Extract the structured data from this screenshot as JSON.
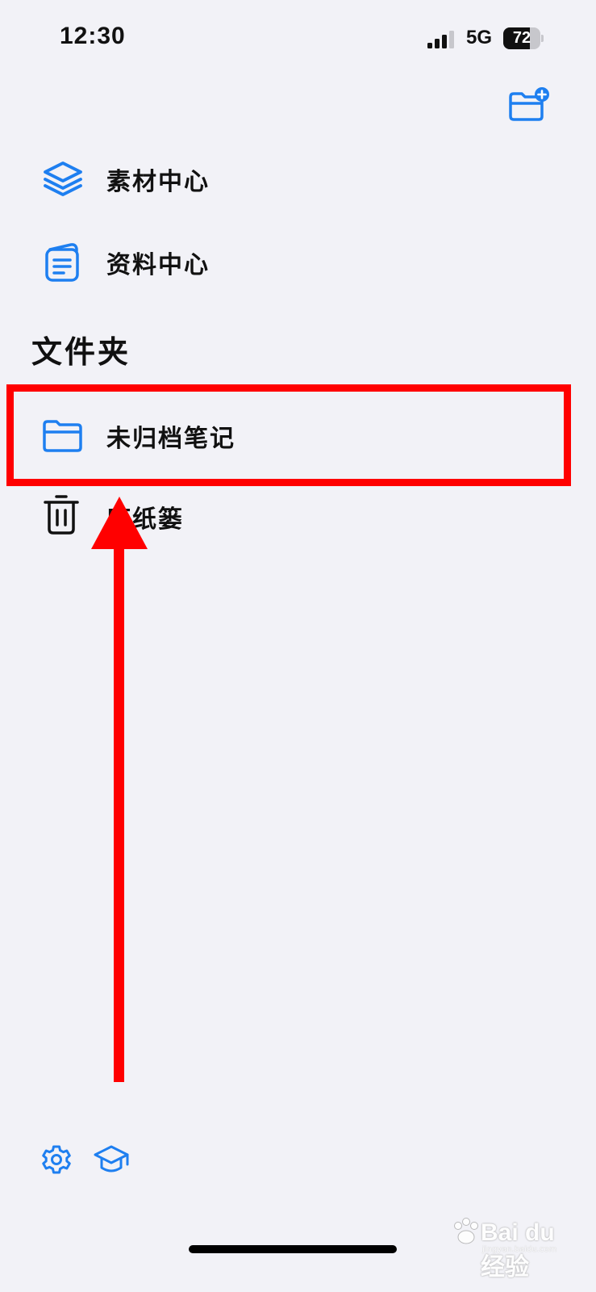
{
  "status_bar": {
    "time": "12:30",
    "network": "5G",
    "battery_level": "72",
    "battery_fraction": 0.72
  },
  "header": {
    "new_folder_icon": "folder-plus-icon"
  },
  "library": {
    "items": [
      {
        "label": "素材中心",
        "icon": "stack-layers-icon"
      },
      {
        "label": "资料中心",
        "icon": "document-icon"
      }
    ]
  },
  "folders": {
    "title": "文件夹",
    "items": [
      {
        "label": "未归档笔记",
        "icon": "folder-icon"
      },
      {
        "label": "废纸篓",
        "icon": "trash-icon"
      }
    ]
  },
  "toolbar": {
    "settings_icon": "gear-icon",
    "tutorial_icon": "graduation-cap-icon"
  },
  "watermark": {
    "text": "Bai du 经验",
    "sub": "jingyan.baidu.com"
  },
  "colors": {
    "accent": "#1e7ff0",
    "background": "#f2f2f7",
    "annotation": "#ff0000"
  }
}
